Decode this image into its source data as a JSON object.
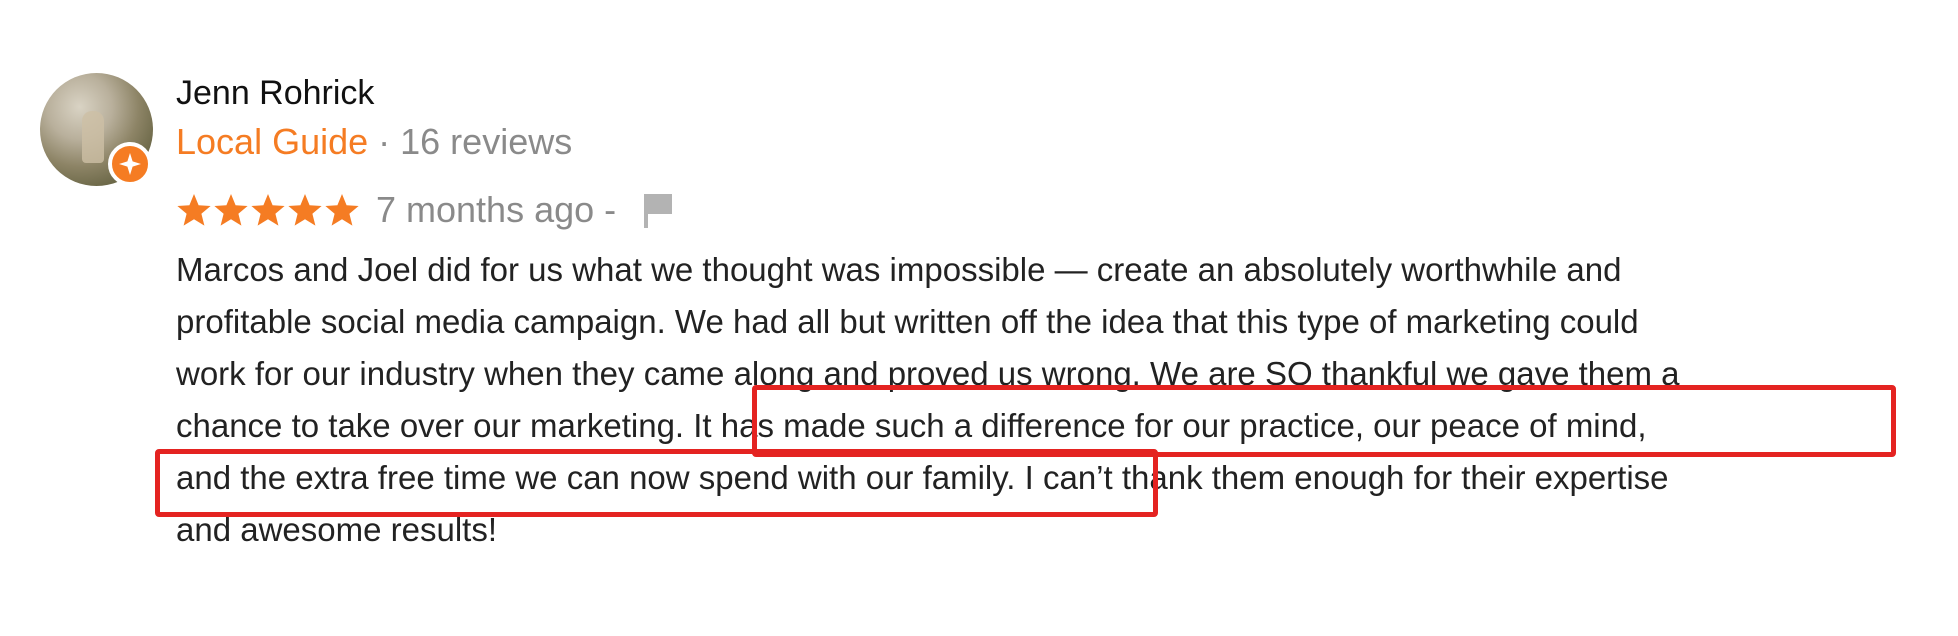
{
  "reviewer": {
    "name": "Jenn Rohrick",
    "badge": "Local Guide",
    "separator": " · ",
    "reviews_count": "16 reviews"
  },
  "rating": {
    "stars": 5,
    "time": "7 months ago",
    "dash": "-"
  },
  "review_lines": [
    "Marcos and Joel did for us what we thought was impossible — create an absolutely worthwhile and",
    "profitable social media campaign. We had all but written off the idea that this type of marketing could",
    "work for our industry when they came along and proved us wrong. We are SO thankful we gave them a",
    "chance to take over our marketing. It has made such a difference for our practice, our peace of mind,",
    "and the extra free time we can now spend with our family. I can’t thank them enough for their expertise",
    "and awesome results!"
  ],
  "colors": {
    "accent": "#f57c23",
    "highlight_border": "#e42321",
    "muted_text": "#8a8a8a",
    "body_text": "#222222"
  },
  "icons": {
    "badge": "local-guide-badge-icon",
    "star": "star-icon",
    "flag": "flag-icon"
  }
}
